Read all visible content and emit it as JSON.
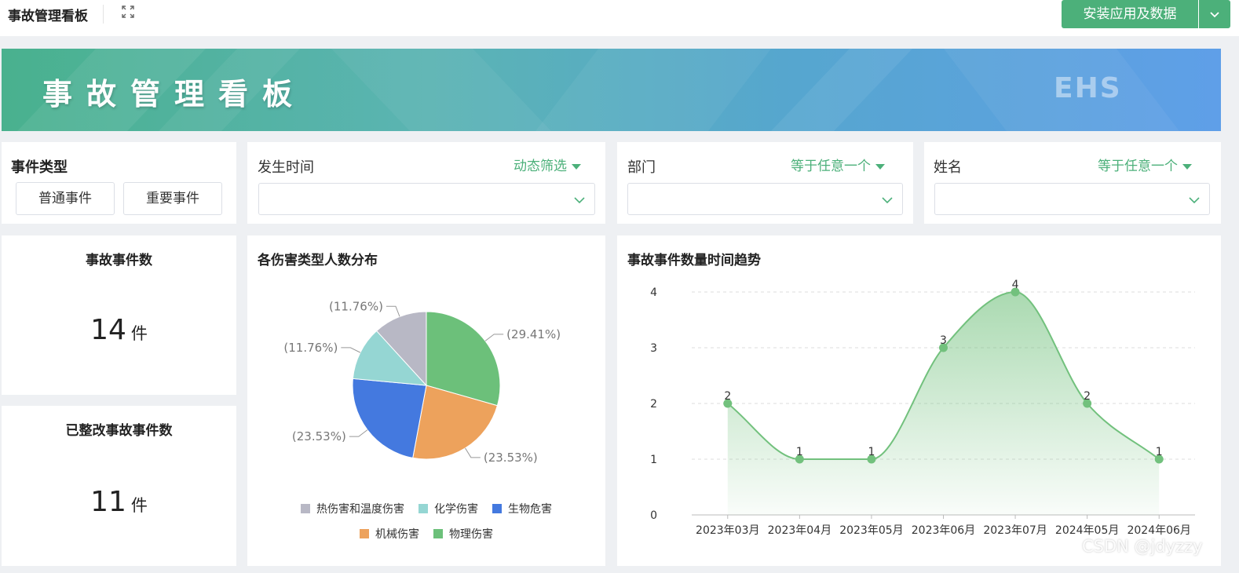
{
  "topbar": {
    "title": "事故管理看板",
    "install_label": "安装应用及数据"
  },
  "banner": {
    "title": "事故管理看板",
    "logo_text": "EHS"
  },
  "filters": {
    "event_type": {
      "label": "事件类型",
      "options": [
        "普通事件",
        "重要事件"
      ]
    },
    "time": {
      "label": "发生时间",
      "mode": "动态筛选",
      "value": ""
    },
    "department": {
      "label": "部门",
      "mode": "等于任意一个",
      "value": ""
    },
    "name": {
      "label": "姓名",
      "mode": "等于任意一个",
      "value": ""
    }
  },
  "kpis": [
    {
      "title": "事故事件数",
      "value": "14",
      "unit": "件"
    },
    {
      "title": "已整改事故事件数",
      "value": "11",
      "unit": "件"
    }
  ],
  "pie_title": "各伤害类型人数分布",
  "line_title": "事故事件数量时间趋势",
  "colors": {
    "accent": "#4cb07a",
    "pie": [
      "#6cc07a",
      "#eda25c",
      "#4479df",
      "#95d6d3",
      "#b8b8c5"
    ],
    "line": "#72c17d"
  },
  "chart_data": [
    {
      "type": "pie",
      "title": "各伤害类型人数分布",
      "slices": [
        {
          "name": "物理伤害",
          "percent": 29.41,
          "label": "(29.41%)"
        },
        {
          "name": "机械伤害",
          "percent": 23.53,
          "label": "(23.53%)"
        },
        {
          "name": "生物危害",
          "percent": 23.53,
          "label": "(23.53%)"
        },
        {
          "name": "化学伤害",
          "percent": 11.76,
          "label": "(11.76%)"
        },
        {
          "name": "热伤害和温度伤害",
          "percent": 11.76,
          "label": "(11.76%)"
        }
      ],
      "legend_order": [
        "热伤害和温度伤害",
        "化学伤害",
        "生物危害",
        "机械伤害",
        "物理伤害"
      ],
      "legend_position": "bottom"
    },
    {
      "type": "area",
      "title": "事故事件数量时间趋势",
      "categories": [
        "2023年03月",
        "2023年04月",
        "2023年05月",
        "2023年06月",
        "2023年07月",
        "2024年05月",
        "2024年06月"
      ],
      "values": [
        2,
        1,
        1,
        3,
        4,
        2,
        1
      ],
      "y_ticks": [
        0,
        1,
        2,
        3,
        4
      ],
      "ylim": [
        0,
        4
      ],
      "grid": true,
      "smooth": true,
      "data_labels": true
    }
  ],
  "watermark": "CSDN @jdyzzy"
}
